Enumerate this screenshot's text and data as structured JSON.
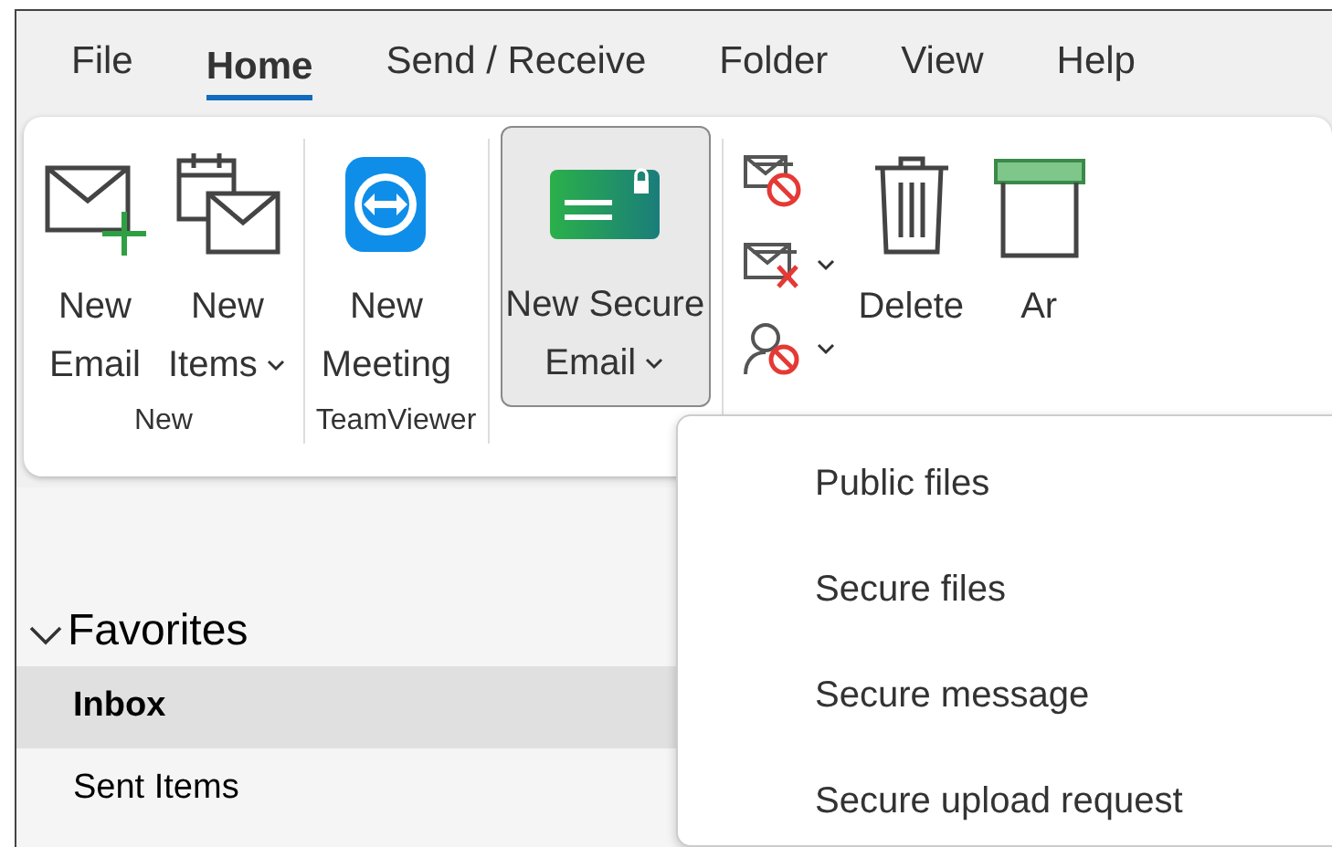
{
  "tabs": [
    {
      "label": "File",
      "selected": false
    },
    {
      "label": "Home",
      "selected": true
    },
    {
      "label": "Send / Receive",
      "selected": false
    },
    {
      "label": "Folder",
      "selected": false
    },
    {
      "label": "View",
      "selected": false
    },
    {
      "label": "Help",
      "selected": false
    }
  ],
  "ribbon": {
    "groups": [
      {
        "label": "New",
        "buttons": [
          {
            "kind": "new-email",
            "lines": [
              "New",
              "Email"
            ],
            "dropdown": false,
            "pressed": false
          },
          {
            "kind": "new-items",
            "lines": [
              "New",
              "Items"
            ],
            "dropdown": true,
            "pressed": false
          }
        ]
      },
      {
        "label": "TeamViewer",
        "buttons": [
          {
            "kind": "teamviewer",
            "lines": [
              "New",
              "Meeting"
            ],
            "dropdown": false,
            "pressed": false
          }
        ]
      },
      {
        "buttons": [
          {
            "kind": "secure-email",
            "lines": [
              "New Secure",
              "Email"
            ],
            "dropdown": true,
            "pressed": true
          }
        ]
      },
      {
        "buttons": [
          {
            "kind": "small-stack",
            "items": [
              {
                "kind": "ignore",
                "dropdown": false
              },
              {
                "kind": "junk",
                "dropdown": true
              },
              {
                "kind": "block",
                "dropdown": true
              }
            ]
          },
          {
            "kind": "delete",
            "lines": [
              "Delete"
            ],
            "dropdown": false,
            "pressed": false
          },
          {
            "kind": "archive",
            "lines": [
              "Ar"
            ],
            "dropdown": false,
            "pressed": false
          }
        ]
      }
    ]
  },
  "folders": {
    "header": "Favorites",
    "expanded": true,
    "items": [
      {
        "label": "Inbox",
        "selected": true
      },
      {
        "label": "Sent Items",
        "selected": false
      }
    ]
  },
  "menu": {
    "items": [
      "Public files",
      "Secure files",
      "Secure message",
      "Secure upload request"
    ]
  }
}
